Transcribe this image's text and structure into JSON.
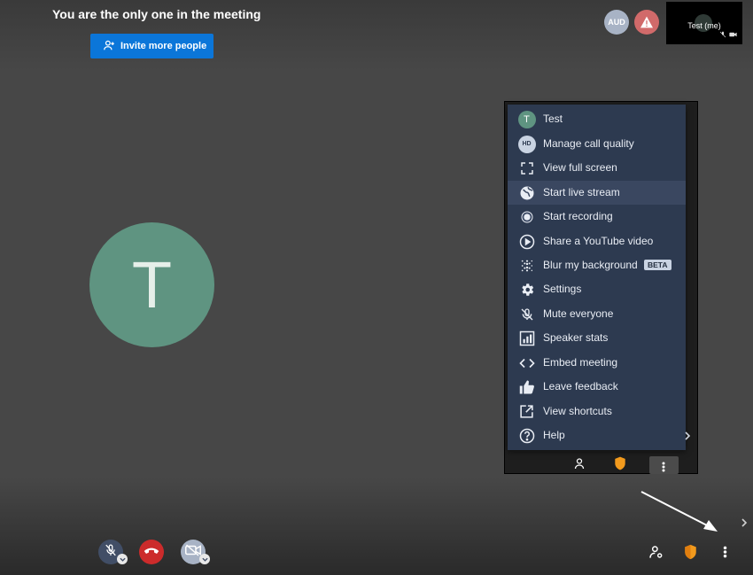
{
  "meeting": {
    "notice": "You are the only one in the meeting",
    "invite_label": "Invite more people",
    "participant_initial": "T"
  },
  "header": {
    "audio_badge": "AUD",
    "self_view_name": "Test (me)"
  },
  "menu": {
    "items": [
      {
        "label": "Test",
        "icon": "avatar-t"
      },
      {
        "label": "Manage call quality",
        "icon": "hd-icon",
        "icon_text": "HD"
      },
      {
        "label": "View full screen",
        "icon": "fullscreen-icon"
      },
      {
        "label": "Start live stream",
        "icon": "globe-icon"
      },
      {
        "label": "Start recording",
        "icon": "record-icon"
      },
      {
        "label": "Share a YouTube video",
        "icon": "play-circle-icon"
      },
      {
        "label": "Blur my background",
        "icon": "blur-icon",
        "badge": "BETA"
      },
      {
        "label": "Settings",
        "icon": "gear-icon"
      },
      {
        "label": "Mute everyone",
        "icon": "mic-off-icon"
      },
      {
        "label": "Speaker stats",
        "icon": "stats-icon"
      },
      {
        "label": "Embed meeting",
        "icon": "code-icon"
      },
      {
        "label": "Leave feedback",
        "icon": "thumbs-up-icon"
      },
      {
        "label": "View shortcuts",
        "icon": "external-link-icon"
      },
      {
        "label": "Help",
        "icon": "help-icon"
      }
    ],
    "highlighted_index": 3
  },
  "colors": {
    "background": "#474747",
    "menu_bg": "#2d3a50",
    "invite_button": "#0b76d9",
    "avatar": "#5f9481",
    "hangup": "#cc2b2b",
    "security_shield": "#f29a1d"
  }
}
